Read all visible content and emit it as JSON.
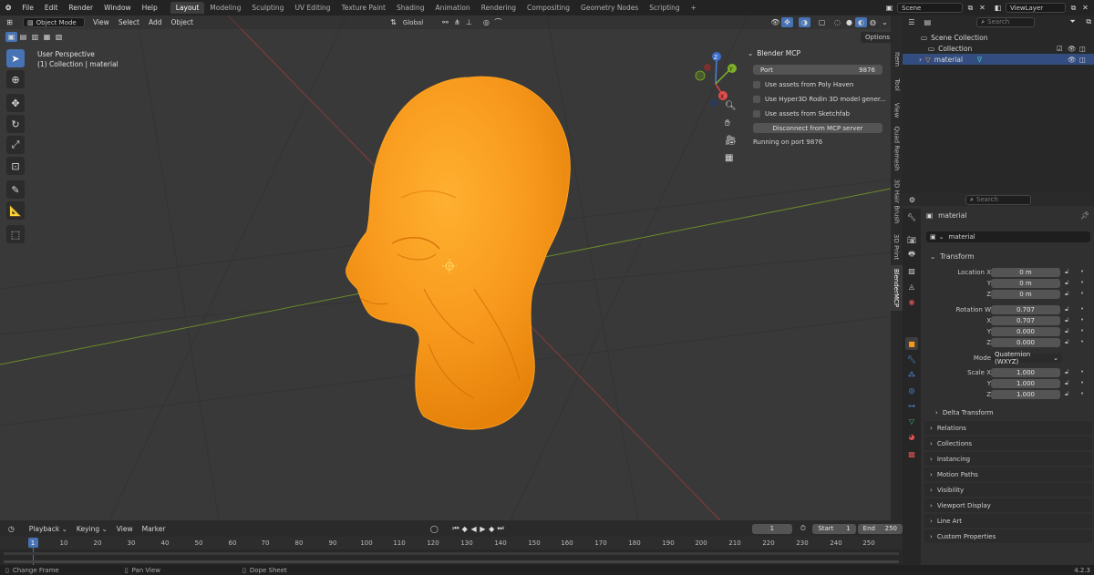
{
  "menu": [
    "File",
    "Edit",
    "Render",
    "Window",
    "Help"
  ],
  "workspace_tabs": [
    {
      "label": "Layout",
      "active": true
    },
    {
      "label": "Modeling"
    },
    {
      "label": "Sculpting"
    },
    {
      "label": "UV Editing"
    },
    {
      "label": "Texture Paint"
    },
    {
      "label": "Shading"
    },
    {
      "label": "Animation"
    },
    {
      "label": "Rendering"
    },
    {
      "label": "Compositing"
    },
    {
      "label": "Geometry Nodes"
    },
    {
      "label": "Scripting"
    }
  ],
  "add_tab": "+",
  "scene": {
    "label": "Scene"
  },
  "view_layer": {
    "label": "ViewLayer"
  },
  "viewport": {
    "mode": "Object Mode",
    "menu": [
      "View",
      "Select",
      "Add",
      "Object"
    ],
    "transform_orientation": "Global",
    "options_label": "Options",
    "overlay_title": "User Perspective",
    "overlay_subtitle": "(1) Collection | material",
    "gizmo": {
      "z": "Z",
      "y": "Y",
      "x": "X"
    }
  },
  "mcp_panel": {
    "title": "Blender MCP",
    "port_label": "Port",
    "port_value": "9876",
    "checks": [
      "Use assets from Poly Haven",
      "Use Hyper3D Rodin 3D model gener...",
      "Use assets from Sketchfab"
    ],
    "disconnect_label": "Disconnect from MCP server",
    "status": "Running on port 9876"
  },
  "side_tabs": [
    "Item",
    "Tool",
    "View",
    "Quad Remesh",
    "3D Hair Brush",
    "3D Print",
    "BlenderMCP"
  ],
  "outliner": {
    "search_placeholder": "Search",
    "root": "Scene Collection",
    "collection": "Collection",
    "object": "material"
  },
  "properties": {
    "search_placeholder": "Search",
    "object_name": "material",
    "data_name": "material",
    "transform_header": "Transform",
    "location_label": "Location X",
    "y_label": "Y",
    "z_label": "Z",
    "x_label": "X",
    "location": [
      "0 m",
      "0 m",
      "0 m"
    ],
    "rotation_label": "Rotation W",
    "rotation": [
      "0.707",
      "0.707",
      "0.000",
      "0.000"
    ],
    "mode_label": "Mode",
    "mode_value": "Quaternion (WXYZ)",
    "scale_label": "Scale X",
    "scale": [
      "1.000",
      "1.000",
      "1.000"
    ],
    "delta_transform": "Delta Transform",
    "sections": [
      "Relations",
      "Collections",
      "Instancing",
      "Motion Paths",
      "Visibility",
      "Viewport Display",
      "Line Art",
      "Custom Properties"
    ]
  },
  "timeline": {
    "menu": [
      "Playback",
      "Keying",
      "View",
      "Marker"
    ],
    "current_frame": "1",
    "start_label": "Start",
    "start_value": "1",
    "end_label": "End",
    "end_value": "250",
    "ticks": [
      "1",
      "10",
      "20",
      "30",
      "40",
      "50",
      "60",
      "70",
      "80",
      "90",
      "100",
      "110",
      "120",
      "130",
      "140",
      "150",
      "160",
      "170",
      "180",
      "190",
      "200",
      "210",
      "220",
      "230",
      "240",
      "250"
    ]
  },
  "status_bar": {
    "items": [
      "Change Frame",
      "Pan View",
      "Dope Sheet"
    ],
    "version": "4.2.3"
  },
  "colors": {
    "accent": "#4772b3",
    "object": "#ff9a1f",
    "selected_row": "#334d80"
  }
}
